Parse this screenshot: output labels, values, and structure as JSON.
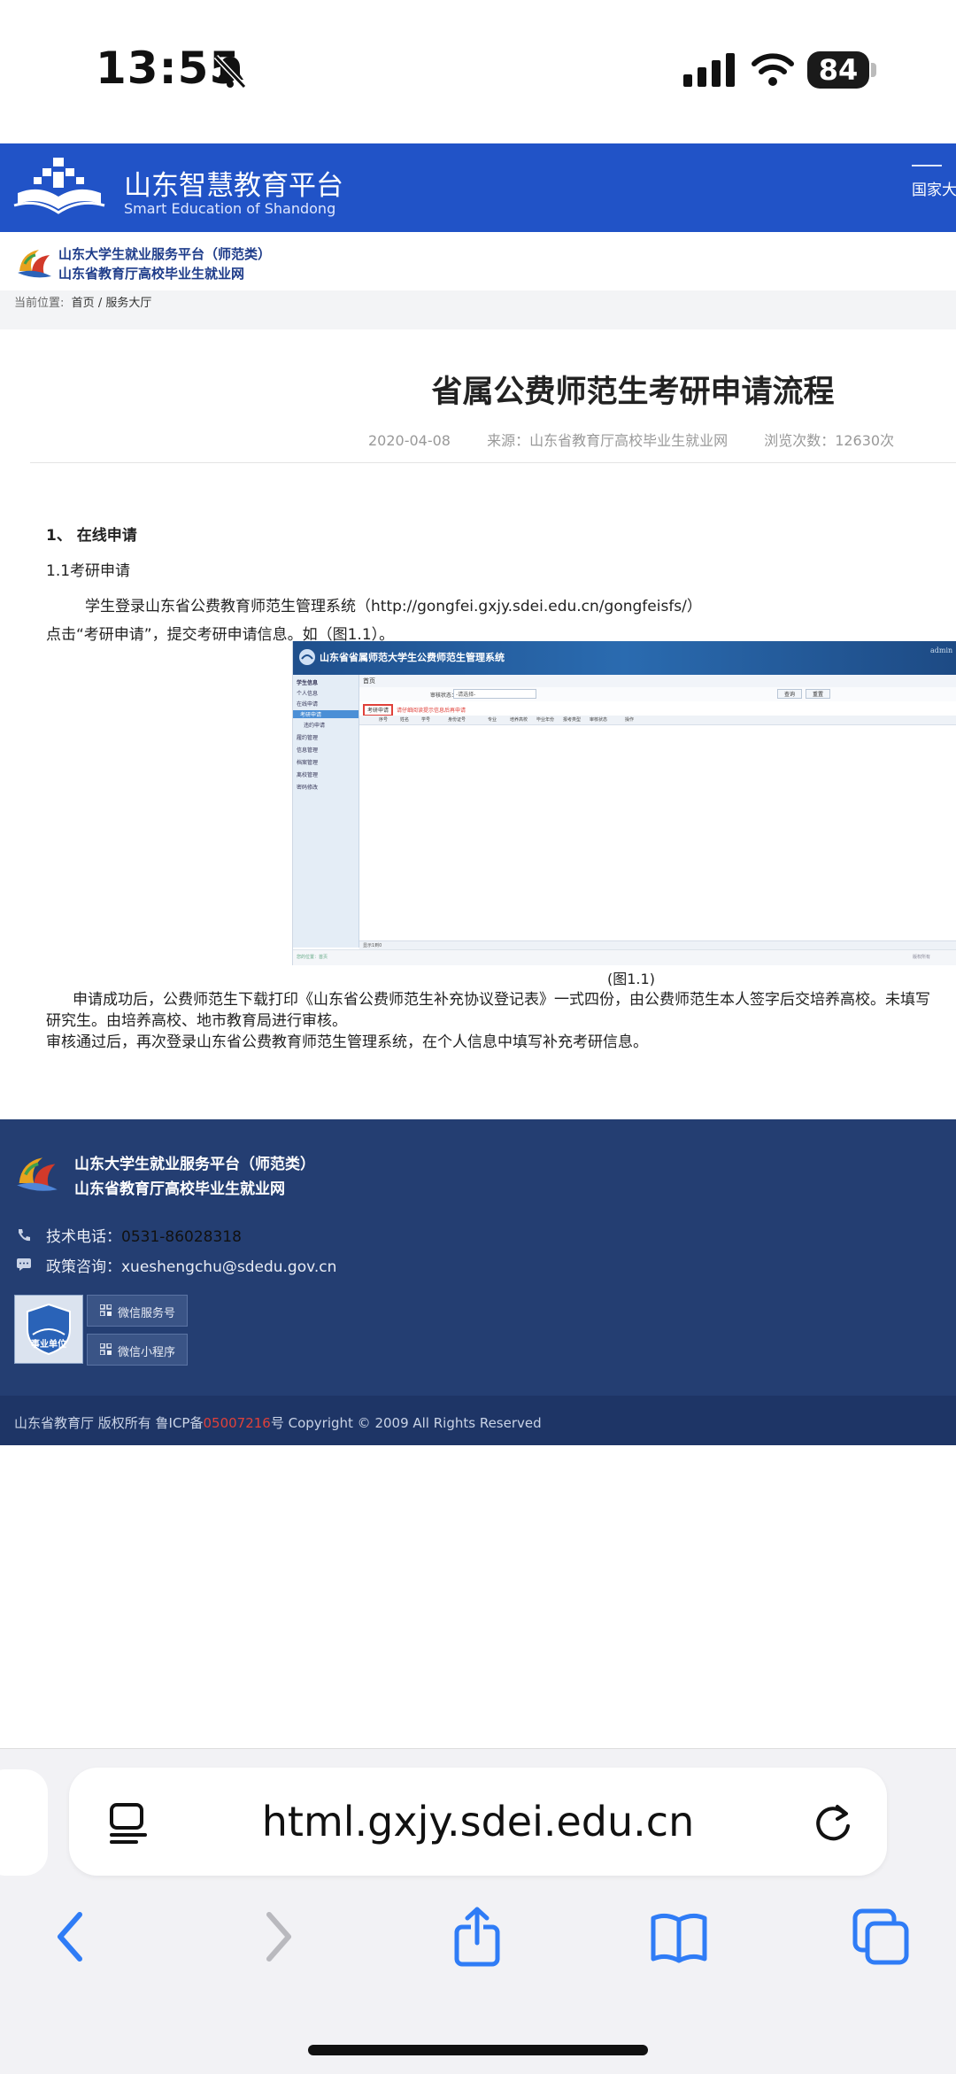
{
  "status": {
    "time": "13:55",
    "battery": "84"
  },
  "header": {
    "brand_title": "山东智慧教育平台",
    "brand_sub": "Smart Education of Shandong",
    "right_label": "国家大",
    "sub_line1": "山东大学生就业服务平台（师范类）",
    "sub_line2": "山东省教育厅高校毕业生就业网"
  },
  "breadcrumb": {
    "prefix": "当前位置:",
    "home": "首页",
    "sep": "/",
    "current": "服务大厅"
  },
  "article": {
    "title": "省属公费师范生考研申请流程",
    "date": "2020-04-08",
    "source": "来源：山东省教育厅高校毕业生就业网",
    "views": "浏览次数：12630次",
    "h1": "1、 在线申请",
    "h11": "1.1考研申请",
    "para1": "学生登录山东省公费教育师范生管理系统（http://gongfei.gxjy.sdei.edu.cn/gongfeisfs/）",
    "para1b": "点击“考研申请”，提交考研申请信息。如（图1.1）。",
    "figure_caption": "(图1.1)",
    "para2": "申请成功后，公费师范生下载打印《山东省公费师范生补充协议登记表》一式四份，由公费师范生本人签字后交培养高校。未填写",
    "para2b": "研究生。由培养高校、地市教育局进行审核。",
    "para3": "审核通过后，再次登录山东省公费教育师范生管理系统，在个人信息中填写补充考研信息。"
  },
  "figure": {
    "title": "山东省省属师范大学生公费师范生管理系统",
    "user": "admin",
    "tab": "首页",
    "side_items": [
      "学生信息",
      "个人信息",
      "在线申请",
      "考研申请",
      "违约申请",
      "履约管理",
      "信息管理",
      "档案管理",
      "离校管理",
      "密码修改"
    ],
    "apply_button": "考研申请",
    "notice": "请仔细阅读提示信息后再申请",
    "filter_label": "审核状态：",
    "filter_value": "-请选择-",
    "search_label": "查询",
    "reset_label": "重置",
    "columns": [
      "序号",
      "姓名",
      "学号",
      "身份证号",
      "专业",
      "培养高校",
      "毕业年份",
      "报考类型",
      "审核状态",
      "操作"
    ],
    "pager_info": "显示1到0",
    "bottom_left": "您的位置：首页",
    "bottom_right": "版权所有"
  },
  "footer": {
    "line1": "山东大学生就业服务平台（师范类）",
    "line2": "山东省教育厅高校毕业生就业网",
    "tel_label": "技术电话：",
    "tel": "0531-86028318",
    "mail_label": "政策咨询：",
    "mail": "xueshengchu@sdedu.gov.cn",
    "badge": "事业单位",
    "wechat_service": "微信服务号",
    "wechat_mini": "微信小程序",
    "copyright_prefix": "山东省教育厅 版权所有 鲁ICP备",
    "icp_no": "05007216",
    "copyright_suffix": "号 Copyright © 2009 All Rights Reserved"
  },
  "browser": {
    "url": "html.gxjy.sdei.edu.cn"
  },
  "colors": {
    "brand": "#2153c7",
    "footer": "#243e72",
    "icp": "#e0413a"
  }
}
